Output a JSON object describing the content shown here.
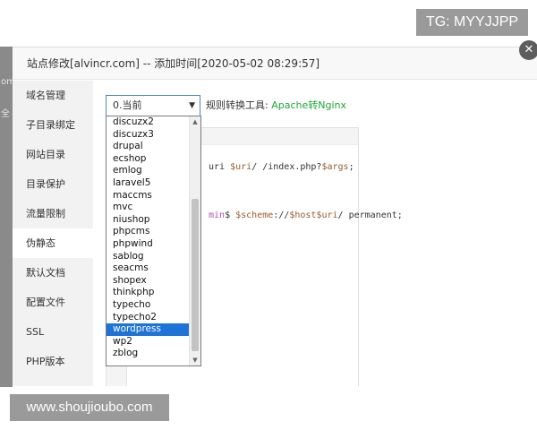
{
  "dialog": {
    "title": "站点修改[alvincr.com] -- 添加时间[2020-05-02 08:29:57]",
    "close_icon": "close-icon"
  },
  "background": {
    "fragments": [
      "om",
      "全"
    ]
  },
  "sidebar": {
    "items": [
      {
        "label": "域名管理"
      },
      {
        "label": "子目录绑定"
      },
      {
        "label": "网站目录"
      },
      {
        "label": "目录保护"
      },
      {
        "label": "流量限制"
      },
      {
        "label": "伪静态",
        "active": true
      },
      {
        "label": "默认文档"
      },
      {
        "label": "配置文件"
      },
      {
        "label": "SSL"
      },
      {
        "label": "PHP版本"
      }
    ]
  },
  "rewrite": {
    "selected_value": "0.当前",
    "tool_label": "规则转换工具:",
    "tool_link": "Apache转Nginx",
    "options": [
      "discuzx2",
      "discuzx3",
      "drupal",
      "ecshop",
      "emlog",
      "laravel5",
      "maccms",
      "mvc",
      "niushop",
      "phpcms",
      "phpwind",
      "sablog",
      "seacms",
      "shopex",
      "thinkphp",
      "typecho",
      "typecho2",
      "wordpress",
      "wp2",
      "zblog"
    ],
    "highlighted": "wordpress"
  },
  "editor": {
    "line1_a": "uri ",
    "line1_b": "$uri",
    "line1_c": "/ /index.php?",
    "line1_d": "$args",
    "line1_e": ";",
    "line2_a": "min",
    "line2_b": "$ ",
    "line2_c": "$scheme",
    "line2_d": "://",
    "line2_e": "$host",
    "line2_f": "$uri",
    "line2_g": "/ permanent;"
  },
  "watermarks": {
    "top": "TG: MYYJJPP",
    "bottom": "www.shoujioubo.com"
  }
}
